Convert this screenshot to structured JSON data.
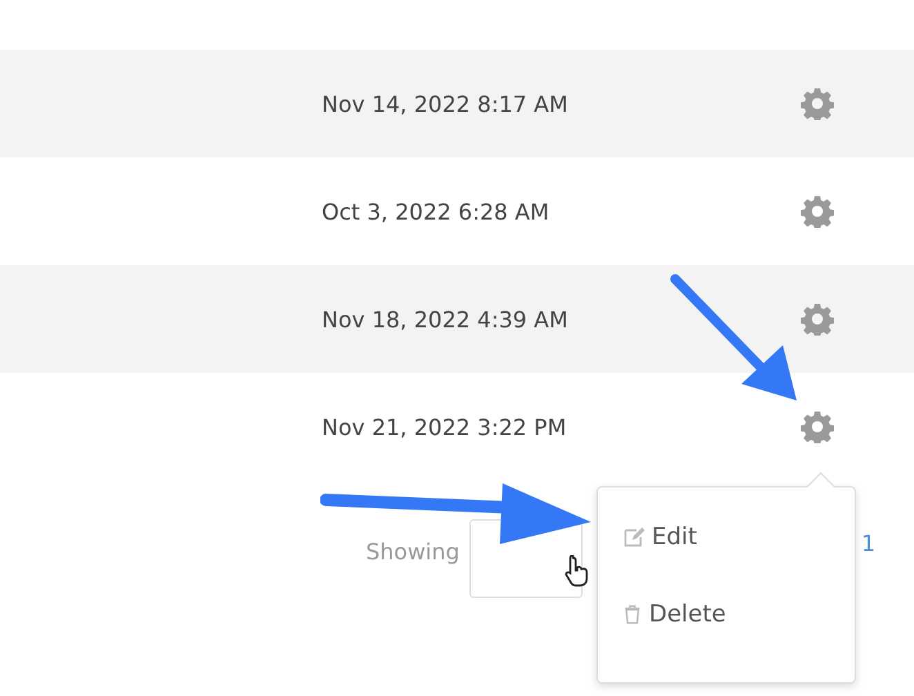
{
  "rows": [
    {
      "date": "Nov 14, 2022 8:17 AM"
    },
    {
      "date": "Oct 3, 2022 6:28 AM"
    },
    {
      "date": "Nov 18, 2022 4:39 AM"
    },
    {
      "date": "Nov 21, 2022 3:22 PM"
    }
  ],
  "footer": {
    "showing_label": "Showing",
    "page_link": "1"
  },
  "menu": {
    "items": [
      {
        "kind": "edit",
        "label": "Edit"
      },
      {
        "kind": "delete",
        "label": "Delete"
      }
    ]
  }
}
